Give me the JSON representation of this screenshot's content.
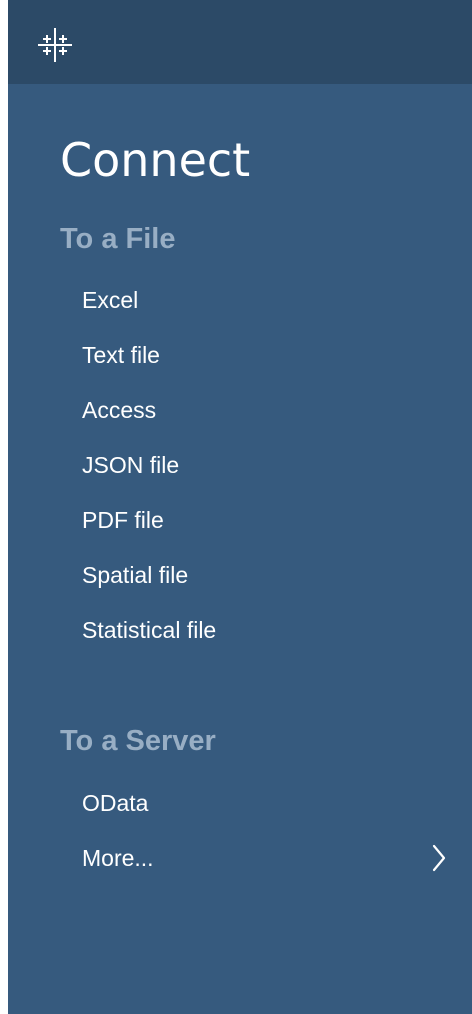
{
  "app": {
    "logo_icon": "tableau-logo-icon"
  },
  "connect": {
    "title": "Connect",
    "to_a_file": {
      "label": "To a File",
      "items": [
        {
          "label": "Excel"
        },
        {
          "label": "Text file"
        },
        {
          "label": "Access"
        },
        {
          "label": "JSON file"
        },
        {
          "label": "PDF file"
        },
        {
          "label": "Spatial file"
        },
        {
          "label": "Statistical file"
        }
      ]
    },
    "to_a_server": {
      "label": "To a Server",
      "items": [
        {
          "label": "OData"
        },
        {
          "label": "More...",
          "icon": "chevron-right-icon"
        }
      ]
    }
  },
  "colors": {
    "panel_bg": "#365a7e",
    "topbar_bg": "#2c4a67",
    "section_text": "#98aec4",
    "item_text": "#ffffff"
  }
}
